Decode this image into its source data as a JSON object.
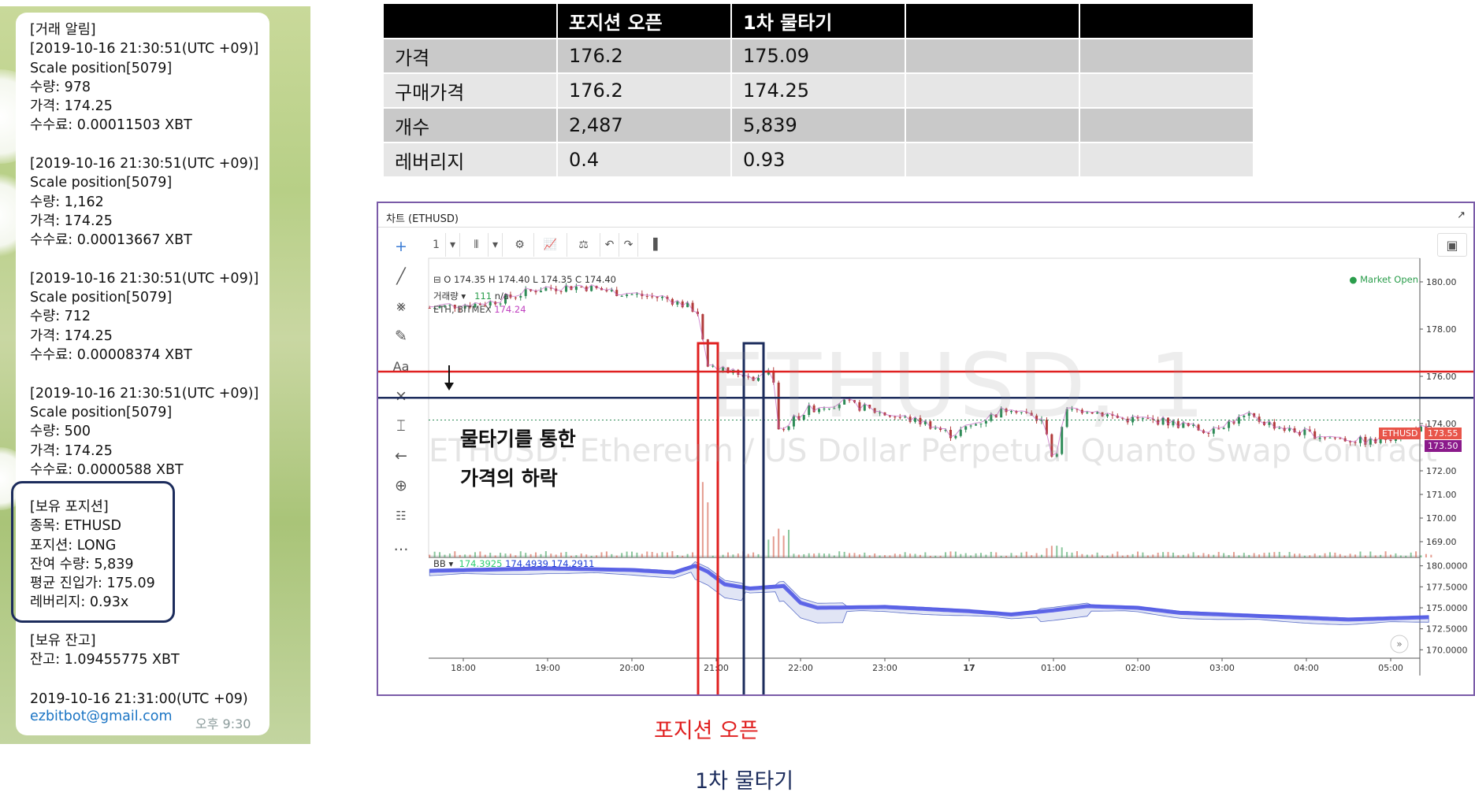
{
  "chat": {
    "trade_alert": {
      "header": "[거래 알림]",
      "fills": [
        {
          "time": "[2019-10-16 21:30:51(UTC +09)]",
          "label": "Scale position[5079]",
          "qty": "수량: 978",
          "price": "가격: 174.25",
          "fee": "수수료: 0.00011503 XBT"
        },
        {
          "time": "[2019-10-16 21:30:51(UTC +09)]",
          "label": "Scale position[5079]",
          "qty": "수량: 1,162",
          "price": "가격: 174.25",
          "fee": "수수료: 0.00013667 XBT"
        },
        {
          "time": "[2019-10-16 21:30:51(UTC +09)]",
          "label": "Scale position[5079]",
          "qty": "수량: 712",
          "price": "가격: 174.25",
          "fee": "수수료: 0.00008374 XBT"
        },
        {
          "time": "[2019-10-16 21:30:51(UTC +09)]",
          "label": "Scale position[5079]",
          "qty": "수량: 500",
          "price": "가격: 174.25",
          "fee": "수수료: 0.0000588 XBT"
        }
      ]
    },
    "position": {
      "header": "[보유 포지션]",
      "symbol": "종목: ETHUSD",
      "side": "포지션: LONG",
      "remaining": "잔여 수량: 5,839",
      "avg_entry": "평균 진입가: 175.09",
      "leverage": "레버리지: 0.93x"
    },
    "balance": {
      "header": "[보유 잔고]",
      "value": "잔고: 1.09455775 XBT"
    },
    "timestamp": "2019-10-16 21:31:00(UTC +09)",
    "email": "ezbitbot@gmail.com",
    "sent_time": "오후 9:30"
  },
  "table": {
    "headers": [
      "",
      "포지션 오픈",
      "1차 물타기",
      "",
      ""
    ],
    "rows": [
      {
        "label": "가격",
        "open": "176.2",
        "add1": "175.09"
      },
      {
        "label": "구매가격",
        "open": "176.2",
        "add1": "174.25"
      },
      {
        "label": "개수",
        "open": "2,487",
        "add1": "5,839"
      },
      {
        "label": "레버리지",
        "open": "0.4",
        "add1": "0.93"
      }
    ]
  },
  "chart": {
    "window_title": "차트 (ETHUSD)",
    "interval": "1",
    "ohlc": "O 174.35 H 174.40 L 174.35 C 174.40",
    "volume_label": "거래량",
    "volume_value": "111",
    "volume_na": "n/a",
    "symbol_label": "ETH, BITMEX",
    "symbol_extra": "174.24",
    "market_status": "Market Open",
    "watermark_symbol": "ETHUSD, 1",
    "watermark_desc": "ETHUSD: Ethereum / US Dollar Perpetual Quanto Swap Contract",
    "annotation_line1": "물타기를 통한",
    "annotation_line2": "가격의 하락",
    "price_axis": [
      "180.00",
      "178.00",
      "176.00",
      "174.00",
      "172.00",
      "171.00",
      "170.00",
      "169.00"
    ],
    "last_price_tag": "173.55",
    "last_price_symbol": "ETHUSD",
    "bid_tag": "173.50",
    "bb_label": "BB",
    "bb_values": [
      "174.3925",
      "174.4939",
      "174.2911"
    ],
    "bb_axis": [
      "180.0000",
      "177.5000",
      "175.0000",
      "172.5000",
      "170.0000"
    ],
    "time_axis": [
      "18:00",
      "19:00",
      "20:00",
      "21:00",
      "22:00",
      "23:00",
      "17",
      "01:00",
      "02:00",
      "03:00",
      "04:00",
      "05:00"
    ],
    "open_price": 176.2,
    "avg_price": 175.09
  },
  "captions": {
    "open": "포지션 오픈",
    "add1": "1차 물타기"
  },
  "colors": {
    "open_marker": "#e02020",
    "add_marker": "#1c2c5c",
    "bb_line": "#4a50e8"
  }
}
